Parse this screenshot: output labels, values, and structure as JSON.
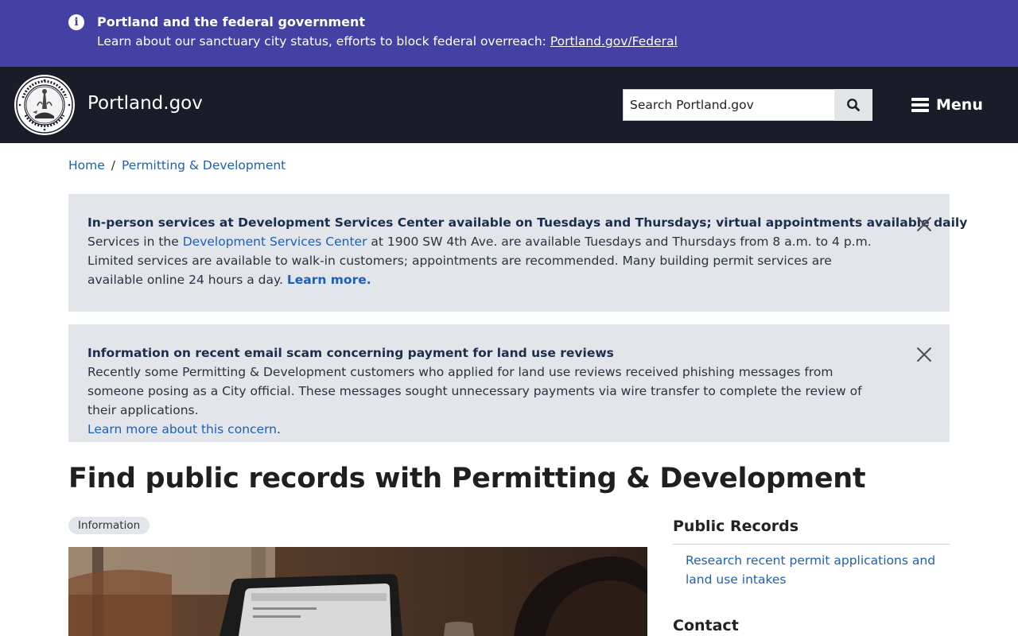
{
  "banner": {
    "icon": "info-icon",
    "title": "Portland and the federal government",
    "text": "Learn about our sanctuary city status, efforts to block federal overreach: ",
    "link": "Portland.gov/Federal"
  },
  "header": {
    "logo_icon": "city-seal-icon",
    "site_name": "Portland.gov",
    "search_placeholder": "Search Portland.gov",
    "search_icon": "search-icon",
    "menu_label": "Menu",
    "menu_icon": "hamburger-icon"
  },
  "breadcrumb": {
    "items": [
      "Home",
      "Permitting & Development"
    ],
    "separator": "/"
  },
  "alerts": [
    {
      "title": "In-person services at Development Services Center available on Tuesdays and Thursdays; virtual appointments available daily",
      "body_pre": "Services in the ",
      "body_link": "Development Services Center",
      "body_post": " at 1900 SW 4th Ave. are available Tuesdays and Thursdays from 8 a.m. to 4 p.m. Limited services are available to walk-in customers; appointments are recommended. Many building permit services are available online 24 hours a day. ",
      "body_link2": "Learn more."
    },
    {
      "title": "Information on recent email scam concerning payment for land use reviews",
      "body_pre": "Recently some Permitting & Development customers who applied for land use reviews received phishing messages from someone posing as a City official. These messages sought unnecessary payments via wire transfer to complete the review of their applications.",
      "body_link": "Learn more about this concern",
      "body_post": "."
    }
  ],
  "main": {
    "title": "Find public records with Permitting & Development",
    "tag": "Information"
  },
  "sidebar": {
    "section1_title": "Public Records",
    "section1_link": "Research recent permit applications and land use intakes",
    "section2_title": "Contact"
  },
  "colors": {
    "banner_bg": "#4341a3",
    "header_bg": "#1b1c29",
    "alert_bg": "#e2e5ea",
    "link": "#1e5fb8"
  }
}
